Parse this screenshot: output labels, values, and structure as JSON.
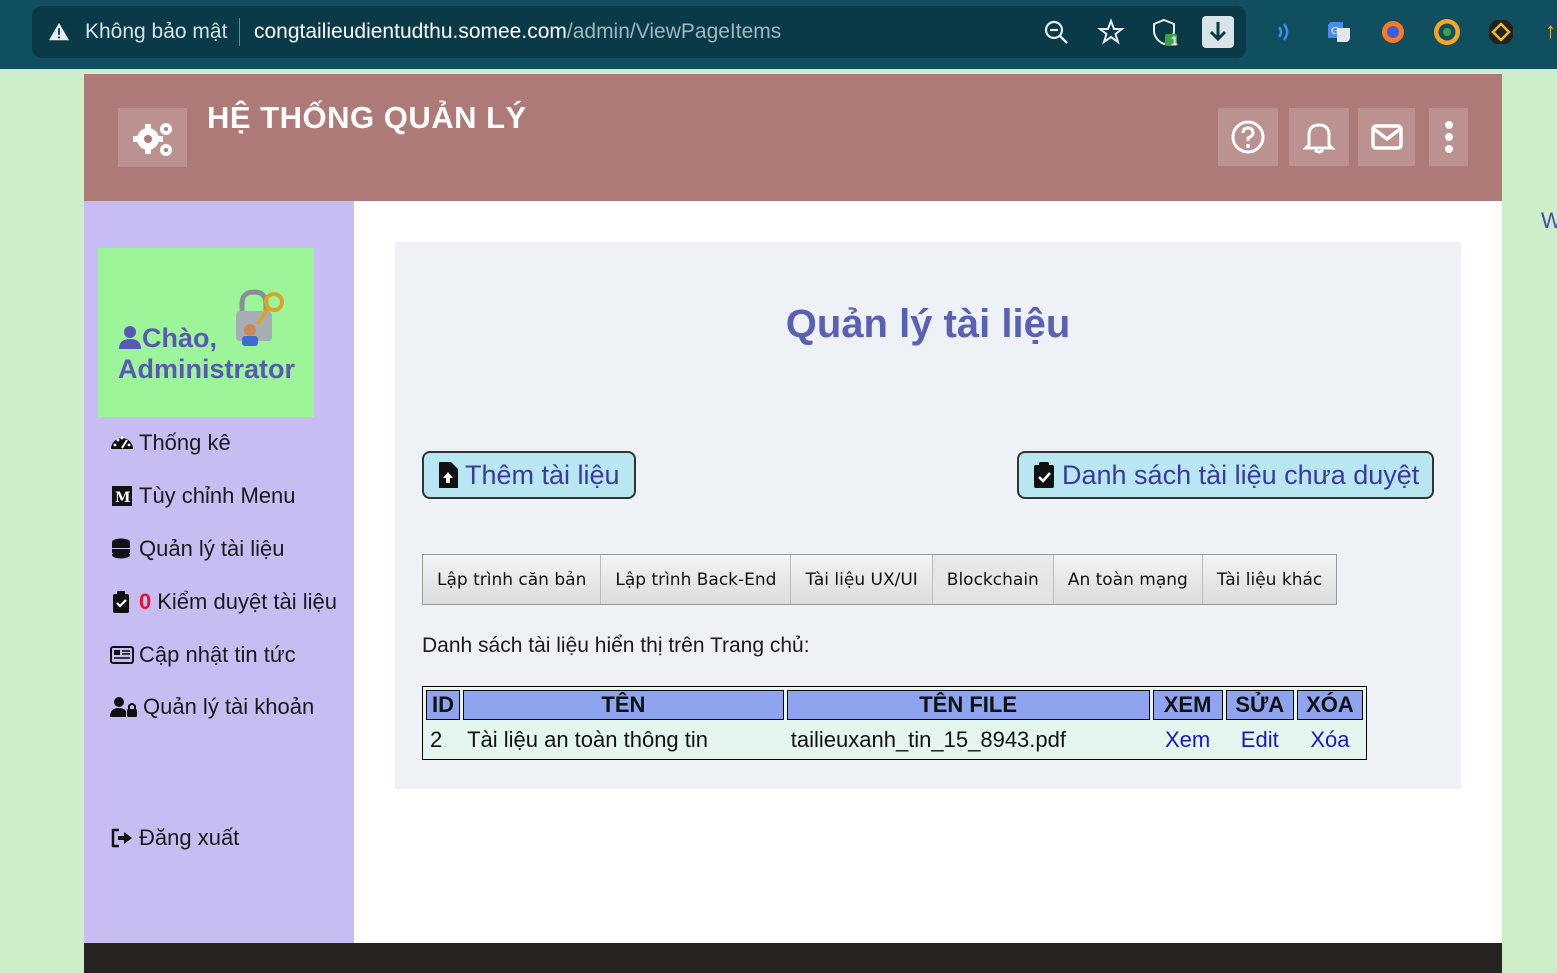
{
  "browser": {
    "security_label": "Không bảo mật",
    "url_host": "congtailieudientudthu.somee.com",
    "url_path": "/admin/ViewPageItems",
    "shield_count": "1"
  },
  "header": {
    "title": "HỆ THỐNG QUẢN LÝ"
  },
  "sidebar": {
    "greeting": "Chào,",
    "username": "Administrator",
    "items": [
      {
        "label": "Thống kê",
        "icon": "dashboard-icon"
      },
      {
        "label": "Tùy chỉnh Menu",
        "icon": "medium-m-icon"
      },
      {
        "label": "Quản lý tài liệu",
        "icon": "database-icon"
      },
      {
        "badge": "0",
        "label": "Kiểm duyệt tài liệu",
        "icon": "clipboard-check-icon"
      },
      {
        "label": "Cập nhật tin tức",
        "icon": "newspaper-icon"
      },
      {
        "label": "Quản lý tài khoản",
        "icon": "user-lock-icon"
      }
    ],
    "logout": "Đăng xuất"
  },
  "main": {
    "heading": "Quản lý tài liệu",
    "add_button": "Thêm tài liệu",
    "pending_button": "Danh sách tài liệu chưa duyệt",
    "tabs": [
      "Lập trình căn bản",
      "Lập trình Back-End",
      "Tài liệu UX/UI",
      "Blockchain",
      "An toàn mạng",
      "Tài liệu khác"
    ],
    "list_label": "Danh sách tài liệu hiển thị trên Trang chủ:",
    "table": {
      "headers": [
        "ID",
        "TÊN",
        "TÊN FILE",
        "XEM",
        "SỬA",
        "XÓA"
      ],
      "rows": [
        {
          "id": "2",
          "name": "Tài liệu an toàn thông tin",
          "file": "tailieuxanh_tin_15_8943.pdf",
          "view": "Xem",
          "edit": "Edit",
          "delete": "Xóa"
        }
      ]
    }
  },
  "edge_text": "W",
  "colors": {
    "header_bg": "#ad7a78",
    "sidebar_bg": "#c7bdf3",
    "welcome_bg": "#9df59a",
    "heading": "#5a61b4",
    "table_header": "#8ea4ee",
    "link": "#1717c8"
  }
}
